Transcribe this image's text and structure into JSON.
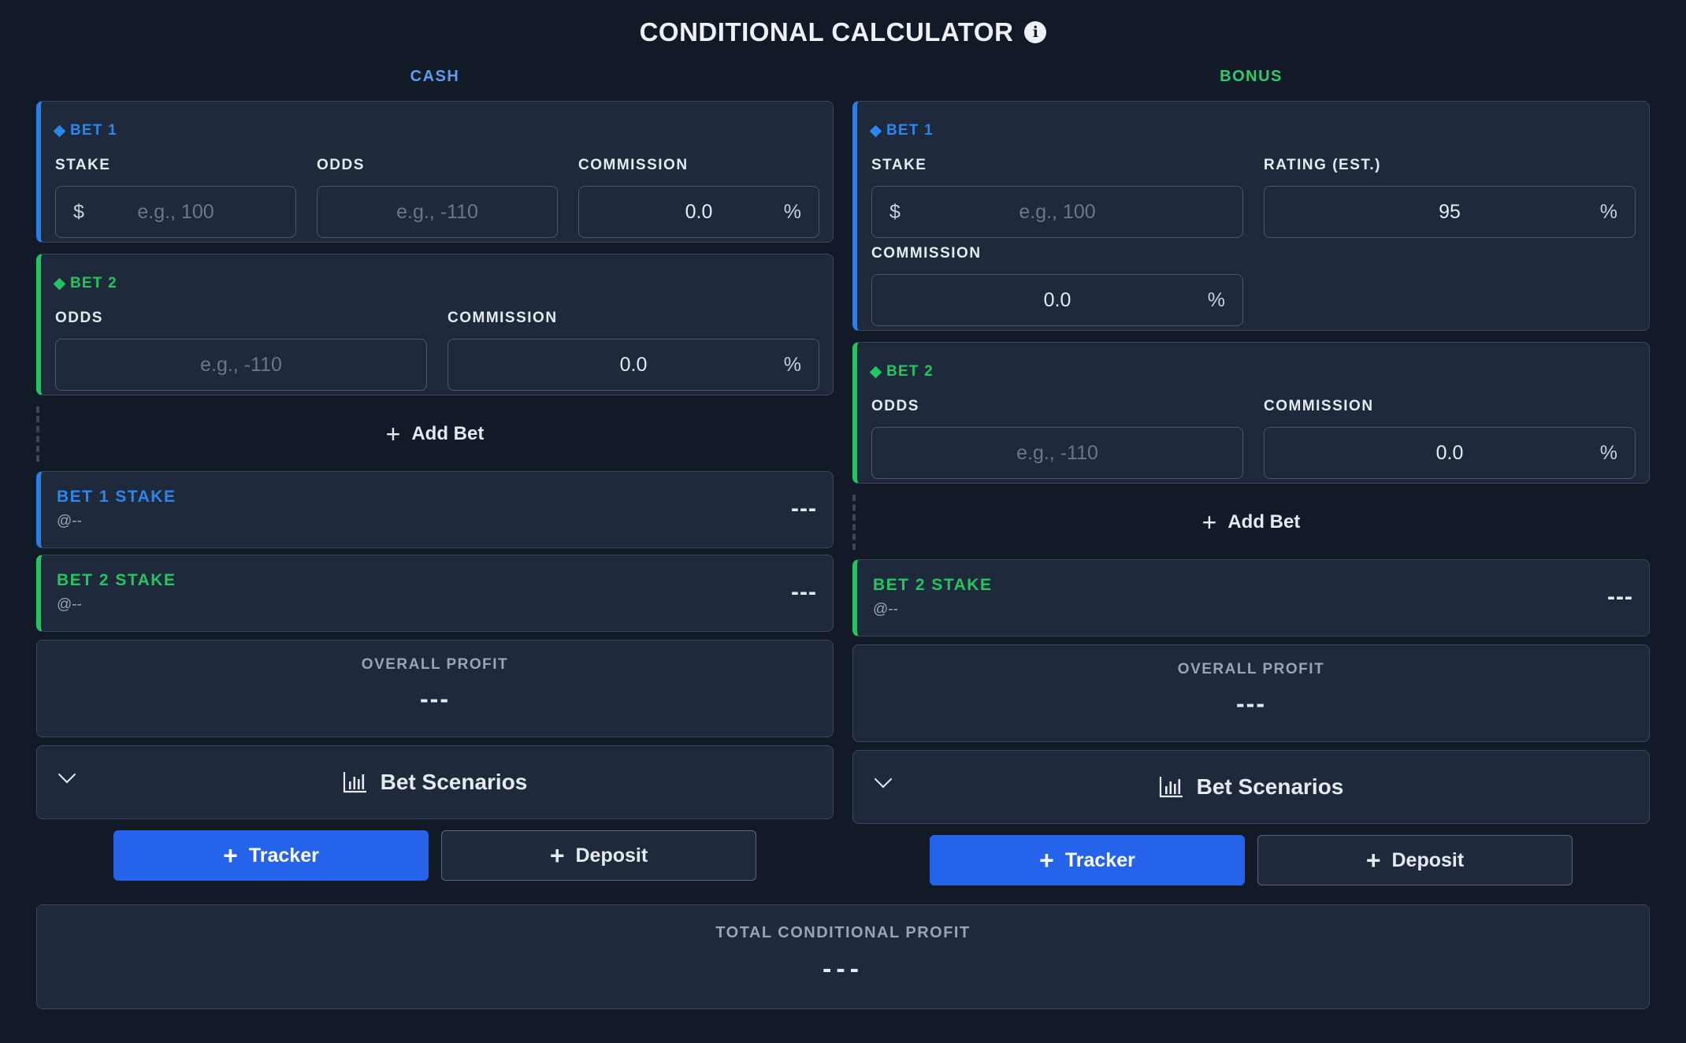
{
  "title": "CONDITIONAL CALCULATOR",
  "info_icon": "info-icon",
  "cash": {
    "label": "CASH",
    "bet1": {
      "header": "BET 1",
      "stake_label": "STAKE",
      "stake_prefix": "$",
      "stake_placeholder": "e.g., 100",
      "odds_label": "ODDS",
      "odds_placeholder": "e.g., -110",
      "commission_label": "COMMISSION",
      "commission_value": "0.0",
      "commission_suffix": "%"
    },
    "bet2": {
      "header": "BET 2",
      "odds_label": "ODDS",
      "odds_placeholder": "e.g., -110",
      "commission_label": "COMMISSION",
      "commission_value": "0.0",
      "commission_suffix": "%"
    },
    "add_bet": "Add Bet",
    "bet1_stake": {
      "title": "BET 1 STAKE",
      "sub": "@--",
      "value": "---"
    },
    "bet2_stake": {
      "title": "BET 2 STAKE",
      "sub": "@--",
      "value": "---"
    },
    "overall_profit": {
      "label": "OVERALL PROFIT",
      "value": "---"
    },
    "scenarios": "Bet Scenarios",
    "tracker": "Tracker",
    "deposit": "Deposit"
  },
  "bonus": {
    "label": "BONUS",
    "bet1": {
      "header": "BET 1",
      "stake_label": "STAKE",
      "stake_prefix": "$",
      "stake_placeholder": "e.g., 100",
      "rating_label": "RATING (EST.)",
      "rating_value": "95",
      "rating_suffix": "%",
      "commission_label": "COMMISSION",
      "commission_value": "0.0",
      "commission_suffix": "%"
    },
    "bet2": {
      "header": "BET 2",
      "odds_label": "ODDS",
      "odds_placeholder": "e.g., -110",
      "commission_label": "COMMISSION",
      "commission_value": "0.0",
      "commission_suffix": "%"
    },
    "add_bet": "Add Bet",
    "bet2_stake": {
      "title": "BET 2 STAKE",
      "sub": "@--",
      "value": "---"
    },
    "overall_profit": {
      "label": "OVERALL PROFIT",
      "value": "---"
    },
    "scenarios": "Bet Scenarios",
    "tracker": "Tracker",
    "deposit": "Deposit"
  },
  "total": {
    "label": "TOTAL CONDITIONAL PROFIT",
    "value": "---"
  },
  "colors": {
    "background": "#111a26",
    "card": "#1e293b",
    "blue": "#2b86f0",
    "green": "#22c55e",
    "primary_button": "#2563eb"
  }
}
